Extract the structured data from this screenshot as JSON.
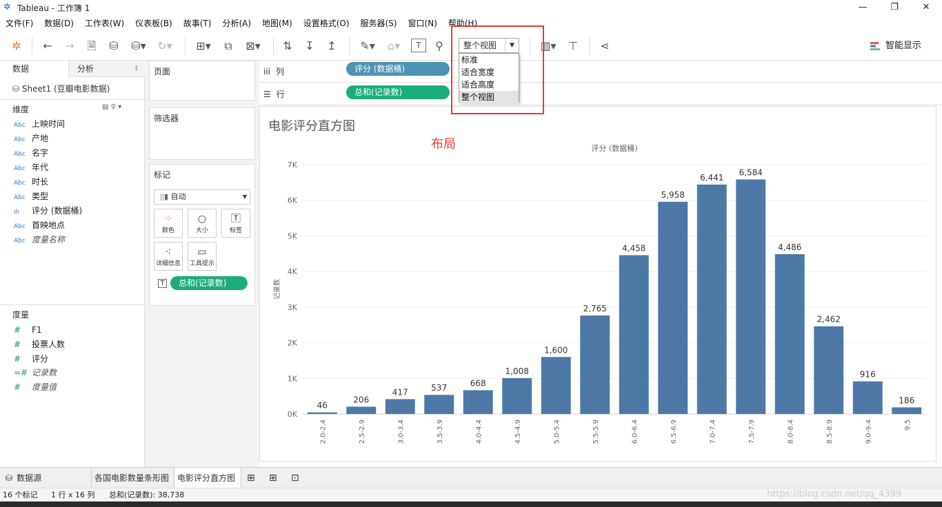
{
  "window": {
    "title": "Tableau - 工作簿 1"
  },
  "menu": [
    "文件(F)",
    "数据(D)",
    "工作表(W)",
    "仪表板(B)",
    "故事(T)",
    "分析(A)",
    "地图(M)",
    "设置格式(O)",
    "服务器(S)",
    "窗口(N)",
    "帮助(H)"
  ],
  "toolbar": {
    "fit_value": "整个视图",
    "smart_show": "智能显示"
  },
  "fit_dropdown": {
    "options": [
      "标准",
      "适合宽度",
      "适合高度",
      "整个视图"
    ],
    "selected": "整个视图"
  },
  "left_pane": {
    "tab_data": "数据",
    "tab_analysis": "分析",
    "datasource": "Sheet1 (豆瓣电影数据)",
    "dimensions_title": "维度",
    "dimensions": [
      {
        "type": "Abc",
        "name": "上映时间"
      },
      {
        "type": "Abc",
        "name": "产地"
      },
      {
        "type": "Abc",
        "name": "名字"
      },
      {
        "type": "Abc",
        "name": "年代"
      },
      {
        "type": "Abc",
        "name": "时长"
      },
      {
        "type": "Abc",
        "name": "类型"
      },
      {
        "type": "ılı",
        "name": "评分 (数据桶)"
      },
      {
        "type": "Abc",
        "name": "首映地点"
      },
      {
        "type": "Abc",
        "name": "度量名称"
      }
    ],
    "measures_title": "度量",
    "measures": [
      {
        "type": "#",
        "name": "F1"
      },
      {
        "type": "#",
        "name": "投票人数"
      },
      {
        "type": "#",
        "name": "评分"
      },
      {
        "type": "=#",
        "name": "记录数"
      },
      {
        "type": "#",
        "name": "度量值"
      }
    ]
  },
  "cards": {
    "pages": "页面",
    "filters": "筛选器",
    "marks": "标记",
    "mark_type": "自动",
    "mark_buttons": [
      "颜色",
      "大小",
      "标签",
      "详细信息",
      "工具提示"
    ],
    "marks_pill": "总和(记录数)"
  },
  "shelves": {
    "columns_label": "列",
    "columns_pill": "评分 (数据桶)",
    "rows_label": "行",
    "rows_pill": "总和(记录数)"
  },
  "annotation": "布局",
  "chart_data": {
    "type": "bar",
    "title": "电影评分直方图",
    "xlabel": "评分 (数据桶)",
    "ylabel": "记录数",
    "categories": [
      "2.0-2.4",
      "2.5-2.9",
      "3.0-3.4",
      "3.5-3.9",
      "4.0-4.4",
      "4.5-4.9",
      "5.0-5.4",
      "5.5-5.9",
      "6.0-6.4",
      "6.5-6.9",
      "7.0-7.4",
      "7.5-7.9",
      "8.0-8.4",
      "8.5-8.9",
      "9.0-9.4",
      "9.5"
    ],
    "values": [
      46,
      206,
      417,
      537,
      668,
      1008,
      1600,
      2765,
      4458,
      5958,
      6441,
      6584,
      4486,
      2462,
      916,
      186
    ],
    "data_labels": [
      "46",
      "206",
      "417",
      "537",
      "668",
      "1,008",
      "1,600",
      "2,765",
      "4,458",
      "5,958",
      "6,441",
      "6,584",
      "4,486",
      "2,462",
      "916",
      "186"
    ],
    "yticks": [
      "0K",
      "1K",
      "2K",
      "3K",
      "4K",
      "5K",
      "6K",
      "7K"
    ],
    "ylim": [
      0,
      7000
    ],
    "bar_color": "#4e79a7",
    "grid": true
  },
  "bottom_tabs": {
    "datasource": "数据源",
    "sheets": [
      "各国电影数量条形图",
      "电影评分直方图"
    ],
    "active": "电影评分直方图"
  },
  "status": {
    "marks": "16 个标记",
    "rows_cols": "1 行 x 16 列",
    "sum": "总和(记录数): 38,738"
  },
  "watermark": "https://blog.csdn.net/qq_4399"
}
